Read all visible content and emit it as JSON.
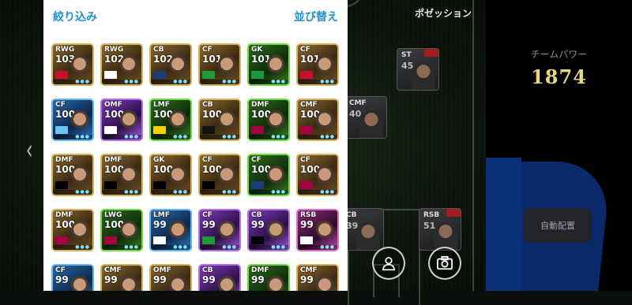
{
  "panel": {
    "filter_label": "絞り込み",
    "sort_label": "並び替え"
  },
  "cards": [
    {
      "position": "RWG",
      "rating": "103",
      "frame": "gold",
      "badge_color": "#c8102e"
    },
    {
      "position": "RWG",
      "rating": "102",
      "frame": "gold",
      "badge_color": "#ffffff"
    },
    {
      "position": "CB",
      "rating": "102",
      "frame": "gold",
      "badge_color": "#1d3c7a"
    },
    {
      "position": "CF",
      "rating": "101",
      "frame": "gold",
      "badge_color": "#1f9a3a"
    },
    {
      "position": "GK",
      "rating": "101",
      "frame": "green",
      "badge_color": "#1f9a3a"
    },
    {
      "position": "CF",
      "rating": "101",
      "frame": "gold",
      "badge_color": "#c8102e"
    },
    {
      "position": "CF",
      "rating": "100",
      "frame": "blue",
      "badge_color": "#6cc3f0"
    },
    {
      "position": "OMF",
      "rating": "100",
      "frame": "purple",
      "badge_color": "#ffffff"
    },
    {
      "position": "LMF",
      "rating": "100",
      "frame": "green",
      "badge_color": "#f5d100"
    },
    {
      "position": "CB",
      "rating": "100",
      "frame": "gold",
      "badge_color": "#111111"
    },
    {
      "position": "DMF",
      "rating": "100",
      "frame": "green",
      "badge_color": "#a50044"
    },
    {
      "position": "CMF",
      "rating": "100",
      "frame": "gold",
      "badge_color": "#a50044"
    },
    {
      "position": "DMF",
      "rating": "100",
      "frame": "gold",
      "badge_color": "#000000"
    },
    {
      "position": "DMF",
      "rating": "100",
      "frame": "gold",
      "badge_color": "#000000"
    },
    {
      "position": "GK",
      "rating": "100",
      "frame": "gold",
      "badge_color": "#000000"
    },
    {
      "position": "CF",
      "rating": "100",
      "frame": "gold",
      "badge_color": "#000000"
    },
    {
      "position": "CF",
      "rating": "100",
      "frame": "green",
      "badge_color": "#1d3c7a"
    },
    {
      "position": "CF",
      "rating": "100",
      "frame": "gold",
      "badge_color": "#a50044"
    },
    {
      "position": "DMF",
      "rating": "100",
      "frame": "gold",
      "badge_color": "#a50044"
    },
    {
      "position": "LWG",
      "rating": "100",
      "frame": "green",
      "badge_color": "#a50044"
    },
    {
      "position": "LMF",
      "rating": "99",
      "frame": "blue",
      "badge_color": "#ffffff"
    },
    {
      "position": "CF",
      "rating": "99",
      "frame": "purple",
      "badge_color": "#1f9a3a"
    },
    {
      "position": "CB",
      "rating": "99",
      "frame": "purple",
      "badge_color": "#000000"
    },
    {
      "position": "RSB",
      "rating": "99",
      "frame": "pink",
      "badge_color": "#ffffff"
    },
    {
      "position": "CF",
      "rating": "99",
      "frame": "blue",
      "badge_color": "#ffffff"
    },
    {
      "position": "CMF",
      "rating": "99",
      "frame": "gold",
      "badge_color": "#ffffff"
    },
    {
      "position": "OMF",
      "rating": "99",
      "frame": "gold",
      "badge_color": "#ffffff"
    },
    {
      "position": "CB",
      "rating": "99",
      "frame": "purple",
      "badge_color": "#ffffff"
    },
    {
      "position": "DMF",
      "rating": "99",
      "frame": "green",
      "badge_color": "#ffffff"
    },
    {
      "position": "CMF",
      "rating": "99",
      "frame": "gold",
      "badge_color": "#ffffff"
    }
  ],
  "formation": {
    "title": "ポゼッション",
    "players": [
      {
        "id": "st",
        "position": "ST",
        "rating": "45"
      },
      {
        "id": "cmf",
        "position": "CMF",
        "rating": "40"
      },
      {
        "id": "cb",
        "position": "CB",
        "rating": "39"
      },
      {
        "id": "rsb",
        "position": "RSB",
        "rating": "51"
      }
    ]
  },
  "team": {
    "power_label": "チームパワー",
    "power_value": "1874",
    "auto_assign_label": "自動配置"
  },
  "colors": {
    "accent_blue": "#1e8fd5",
    "team_power_gold": "#e7d77e"
  },
  "icons": {
    "prev": "chevron-left-icon",
    "person": "person-icon",
    "camera": "camera-icon"
  }
}
